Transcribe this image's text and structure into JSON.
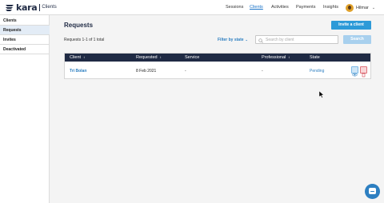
{
  "header": {
    "logo_text": "kara",
    "logo_subtitle": "Clients",
    "nav": [
      "Sessions",
      "Clients",
      "Activities",
      "Payments",
      "Insights"
    ],
    "active_nav": "Clients",
    "user_name": "Hilmar"
  },
  "sidebar": {
    "items": [
      "Clients",
      "Requests",
      "Invites",
      "Deactivated"
    ],
    "active": "Requests"
  },
  "main": {
    "title": "Requests",
    "invite_label": "Invite a client",
    "count_label": "Requests 1-1 of 1 total",
    "filter_label": "Filter by state",
    "search_placeholder": "Search by client",
    "search_label": "Search"
  },
  "table": {
    "columns": [
      "Client",
      "Requested",
      "Service",
      "Professional",
      "State"
    ],
    "rows": [
      {
        "client": "Tri Bolan",
        "requested": "8 Feb 2021",
        "service": "-",
        "professional": "-",
        "state": "Pending"
      }
    ]
  },
  "colors": {
    "accent": "#2d9ad8",
    "header_bg": "#1f2a44",
    "link": "#2d7fc1"
  },
  "icons": [
    "logo-icon",
    "search-icon",
    "chevron-down-icon",
    "sort-icon",
    "eye-icon",
    "trash-icon",
    "chat-icon",
    "cursor-icon"
  ]
}
